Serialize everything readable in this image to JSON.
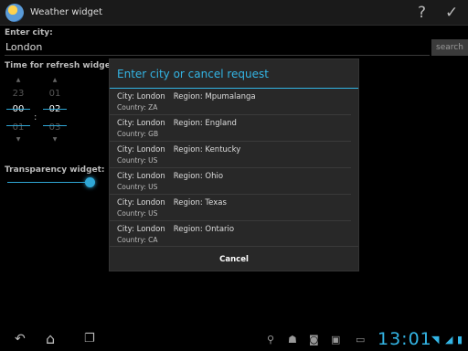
{
  "app": {
    "title": "Weather widget"
  },
  "form": {
    "city_label": "Enter city:",
    "city_value": "London",
    "search_label": "search",
    "refresh_label": "Time for refresh widget:",
    "hours": {
      "prev": "23",
      "current": "00",
      "next": "01"
    },
    "minutes": {
      "prev": "01",
      "current": "02",
      "next": "03"
    },
    "time_separator": ":",
    "transparency_label": "Transparency widget:",
    "transparency_level": 1.0
  },
  "dialog": {
    "title": "Enter city or cancel request",
    "items": [
      {
        "city": "City: London",
        "region": "Region: Mpumalanga",
        "country": "Country: ZA"
      },
      {
        "city": "City: London",
        "region": "Region: England",
        "country": "Country: GB"
      },
      {
        "city": "City: London",
        "region": "Region: Kentucky",
        "country": "Country: US"
      },
      {
        "city": "City: London",
        "region": "Region: Ohio",
        "country": "Country: US"
      },
      {
        "city": "City: London",
        "region": "Region: Texas",
        "country": "Country: US"
      },
      {
        "city": "City: London",
        "region": "Region: Ontario",
        "country": "Country: CA"
      }
    ],
    "cancel_label": "Cancel"
  },
  "status_bar": {
    "time": "13:01"
  },
  "icons": {
    "help": "question-mark-icon",
    "confirm": "checkmark-icon",
    "back": "back-icon",
    "home": "home-icon",
    "recents": "recent-apps-icon"
  },
  "colors": {
    "accent": "#33b5e5",
    "dialog_bg": "#282828",
    "background": "#000000"
  }
}
